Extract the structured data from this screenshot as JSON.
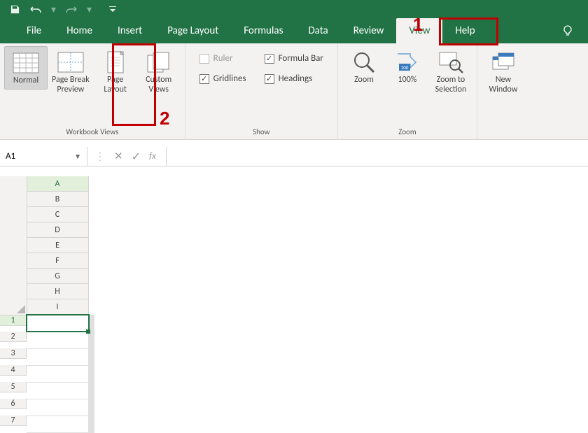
{
  "titlebar": {
    "save": "💾",
    "undo": "↶",
    "redo": "↷",
    "dropdown": "▾"
  },
  "tabs": {
    "file": "File",
    "home": "Home",
    "insert": "Insert",
    "pagelayout": "Page Layout",
    "formulas": "Formulas",
    "data": "Data",
    "review": "Review",
    "view": "View",
    "help": "Help"
  },
  "ribbon": {
    "workbookViews": {
      "normal": "Normal",
      "pageBreak": "Page Break\nPreview",
      "pageLayout": "Page\nLayout",
      "customViews": "Custom\nViews",
      "group": "Workbook Views"
    },
    "show": {
      "ruler": "Ruler",
      "gridlines": "Gridlines",
      "formulaBar": "Formula Bar",
      "headings": "Headings",
      "group": "Show",
      "rulerChecked": false,
      "gridlinesChecked": true,
      "formulaBarChecked": true,
      "headingsChecked": true
    },
    "zoom": {
      "zoom": "Zoom",
      "hundred": "100%",
      "sel": "Zoom to\nSelection",
      "group": "Zoom"
    },
    "window": {
      "new": "New\nWindow"
    }
  },
  "callouts": {
    "one": "1",
    "two": "2"
  },
  "nameBox": "A1",
  "fxLabel": "fx",
  "cols": [
    "A",
    "B",
    "C",
    "D",
    "E",
    "F",
    "G",
    "H",
    "I"
  ],
  "rows": [
    "1",
    "2",
    "3",
    "4",
    "5",
    "6",
    "7"
  ],
  "activeCol": "A",
  "activeRow": "1"
}
